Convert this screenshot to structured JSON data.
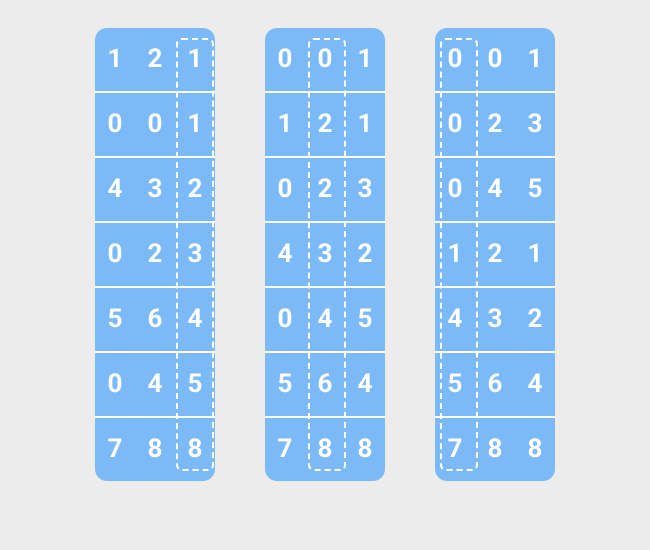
{
  "columns": [
    {
      "selected_index": 2,
      "rows": [
        [
          "1",
          "2",
          "1"
        ],
        [
          "0",
          "0",
          "1"
        ],
        [
          "4",
          "3",
          "2"
        ],
        [
          "0",
          "2",
          "3"
        ],
        [
          "5",
          "6",
          "4"
        ],
        [
          "0",
          "4",
          "5"
        ],
        [
          "7",
          "8",
          "8"
        ]
      ]
    },
    {
      "selected_index": 1,
      "rows": [
        [
          "0",
          "0",
          "1"
        ],
        [
          "1",
          "2",
          "1"
        ],
        [
          "0",
          "2",
          "3"
        ],
        [
          "4",
          "3",
          "2"
        ],
        [
          "0",
          "4",
          "5"
        ],
        [
          "5",
          "6",
          "4"
        ],
        [
          "7",
          "8",
          "8"
        ]
      ]
    },
    {
      "selected_index": 0,
      "rows": [
        [
          "0",
          "0",
          "1"
        ],
        [
          "0",
          "2",
          "3"
        ],
        [
          "0",
          "4",
          "5"
        ],
        [
          "1",
          "2",
          "1"
        ],
        [
          "4",
          "3",
          "2"
        ],
        [
          "5",
          "6",
          "4"
        ],
        [
          "7",
          "8",
          "8"
        ]
      ]
    }
  ]
}
